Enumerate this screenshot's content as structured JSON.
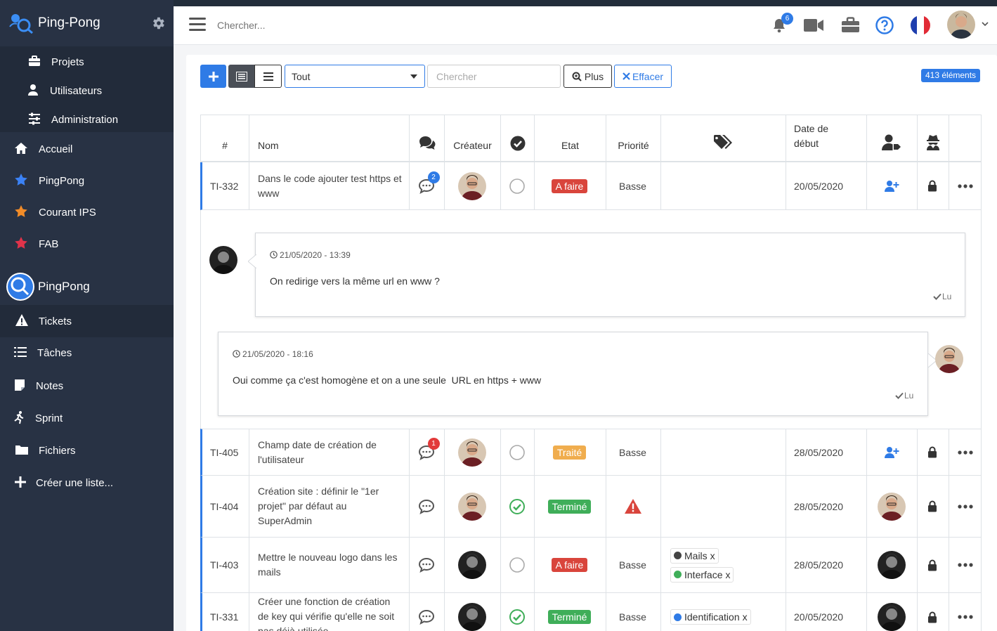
{
  "app": {
    "name": "Ping-Pong"
  },
  "sidebar": {
    "subnav": [
      {
        "label": "Projets",
        "icon": "briefcase-icon"
      },
      {
        "label": "Utilisateurs",
        "icon": "user-icon"
      },
      {
        "label": "Administration",
        "icon": "sliders-icon"
      }
    ],
    "main": [
      {
        "label": "Accueil",
        "icon": "home-icon"
      },
      {
        "label": "PingPong",
        "icon": "star-icon",
        "color": "#3b82f6"
      },
      {
        "label": "Courant IPS",
        "icon": "star-icon",
        "color": "#f28c28"
      },
      {
        "label": "FAB",
        "icon": "star-icon",
        "color": "#e0334a"
      }
    ],
    "project_name": "PingPong",
    "project_items": [
      {
        "label": "Tickets",
        "icon": "warning-icon"
      },
      {
        "label": "Tâches",
        "icon": "tasks-icon"
      },
      {
        "label": "Notes",
        "icon": "note-icon"
      },
      {
        "label": "Sprint",
        "icon": "running-icon"
      },
      {
        "label": "Fichiers",
        "icon": "folder-icon"
      },
      {
        "label": "Créer une liste...",
        "icon": "plus-icon"
      }
    ]
  },
  "header": {
    "search_placeholder": "Chercher...",
    "notifications_count": "6"
  },
  "toolbar": {
    "filter_value": "Tout",
    "search_placeholder": "Chercher",
    "more_label": "Plus",
    "clear_label": "Effacer",
    "count_label": "413 éléments"
  },
  "table": {
    "headers": {
      "id": "#",
      "name": "Nom",
      "creator": "Créateur",
      "state": "Etat",
      "priority": "Priorité",
      "start_date": "Date de début"
    },
    "rows": [
      {
        "id": "TI-332",
        "name": "Dans le code ajouter test https et www",
        "comment_count": "2",
        "creator": "dark-shirt",
        "done": false,
        "state": "A faire",
        "priority": "Basse",
        "tags": [],
        "date": "20/05/2020",
        "assignee": "add"
      },
      {
        "id": "TI-405",
        "name": "Champ date de création de l'utilisateur",
        "comment_count": "1",
        "creator": "dark-shirt",
        "done": false,
        "state": "Traité",
        "priority": "Basse",
        "tags": [],
        "date": "28/05/2020",
        "assignee": "add"
      },
      {
        "id": "TI-404",
        "name": "Création site : définir le \"1er projet\" par défaut au SuperAdmin",
        "comment_count": "",
        "creator": "dark-shirt",
        "done": true,
        "state": "Terminé",
        "priority": "",
        "tags": [],
        "date": "28/05/2020",
        "assignee": "dark-shirt"
      },
      {
        "id": "TI-403",
        "name": "Mettre le nouveau logo dans les mails",
        "comment_count": "",
        "creator": "bw",
        "done": false,
        "state": "A faire",
        "priority": "Basse",
        "tags": [
          {
            "label": "Mails",
            "color": "#444444"
          },
          {
            "label": "Interface",
            "color": "#3fae59"
          }
        ],
        "date": "28/05/2020",
        "assignee": "bw"
      },
      {
        "id": "TI-331",
        "name": "Créer une fonction de création de key qui vérifie qu'elle ne soit pas déjà utilisée",
        "comment_count": "",
        "creator": "bw",
        "done": true,
        "state": "Terminé",
        "priority": "Basse",
        "tags": [
          {
            "label": "Identification",
            "color": "#2f7be6"
          }
        ],
        "date": "20/05/2020",
        "assignee": "bw"
      }
    ]
  },
  "comments": [
    {
      "time": "21/05/2020 - 13:39",
      "text": "On redirige vers la même url en www ?",
      "read": "Lu"
    },
    {
      "time": "21/05/2020 - 18:16",
      "text": "Oui comme ça c'est homogène et on a une seule  URL en https + www",
      "read": "Lu"
    }
  ],
  "tag_remove": "x",
  "colors": {
    "accent": "#2f7be6",
    "sidebar": "#283244",
    "danger": "#d9453c",
    "warning": "#f0ad4e",
    "success": "#3fae59"
  }
}
